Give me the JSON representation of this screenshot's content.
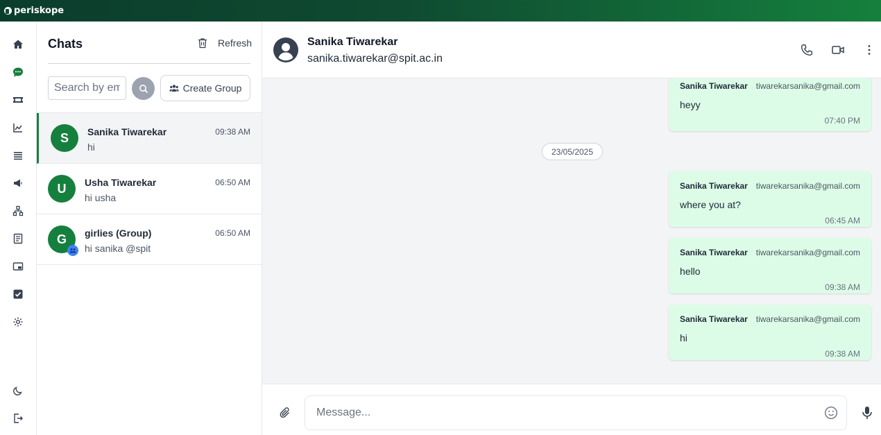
{
  "app": {
    "name": "periskope"
  },
  "rail": {
    "items": [
      {
        "icon": "home-icon"
      },
      {
        "icon": "chat-icon",
        "active": true
      },
      {
        "icon": "ticket-icon"
      },
      {
        "icon": "analytics-icon"
      },
      {
        "icon": "list-icon"
      },
      {
        "icon": "megaphone-icon"
      },
      {
        "icon": "hierarchy-icon"
      },
      {
        "icon": "contacts-book-icon"
      },
      {
        "icon": "media-icon"
      },
      {
        "icon": "checkbox-icon"
      },
      {
        "icon": "gear-icon"
      },
      {
        "icon": "moon-icon"
      },
      {
        "icon": "logout-icon"
      }
    ]
  },
  "chat_list": {
    "title": "Chats",
    "refresh_label": "Refresh",
    "search_placeholder": "Search by email",
    "create_group_label": "Create Group",
    "conversations": [
      {
        "initial": "S",
        "name": "Sanika Tiwarekar",
        "time": "09:38 AM",
        "preview": "hi",
        "active": true
      },
      {
        "initial": "U",
        "name": "Usha Tiwarekar",
        "time": "06:50 AM",
        "preview": "hi usha"
      },
      {
        "initial": "G",
        "name": "girlies (Group)",
        "time": "06:50 AM",
        "preview": "hi sanika @spit",
        "is_group": true
      }
    ]
  },
  "chat": {
    "contact_name": "Sanika Tiwarekar",
    "contact_email": "sanika.tiwarekar@spit.ac.in",
    "date_divider": "23/05/2025",
    "messages": [
      {
        "sender": "Sanika Tiwarekar",
        "email": "tiwarekarsanika@gmail.com",
        "text": "heyy",
        "time": "07:40 PM"
      },
      {
        "sender": "Sanika Tiwarekar",
        "email": "tiwarekarsanika@gmail.com",
        "text": "where you at?",
        "time": "06:45 AM"
      },
      {
        "sender": "Sanika Tiwarekar",
        "email": "tiwarekarsanika@gmail.com",
        "text": "hello",
        "time": "09:38 AM"
      },
      {
        "sender": "Sanika Tiwarekar",
        "email": "tiwarekarsanika@gmail.com",
        "text": "hi",
        "time": "09:38 AM"
      }
    ],
    "input_placeholder": "Message..."
  },
  "colors": {
    "brand": "#15803d",
    "bubble": "#dcfce7",
    "topbar_dark": "#0b3d2c"
  }
}
